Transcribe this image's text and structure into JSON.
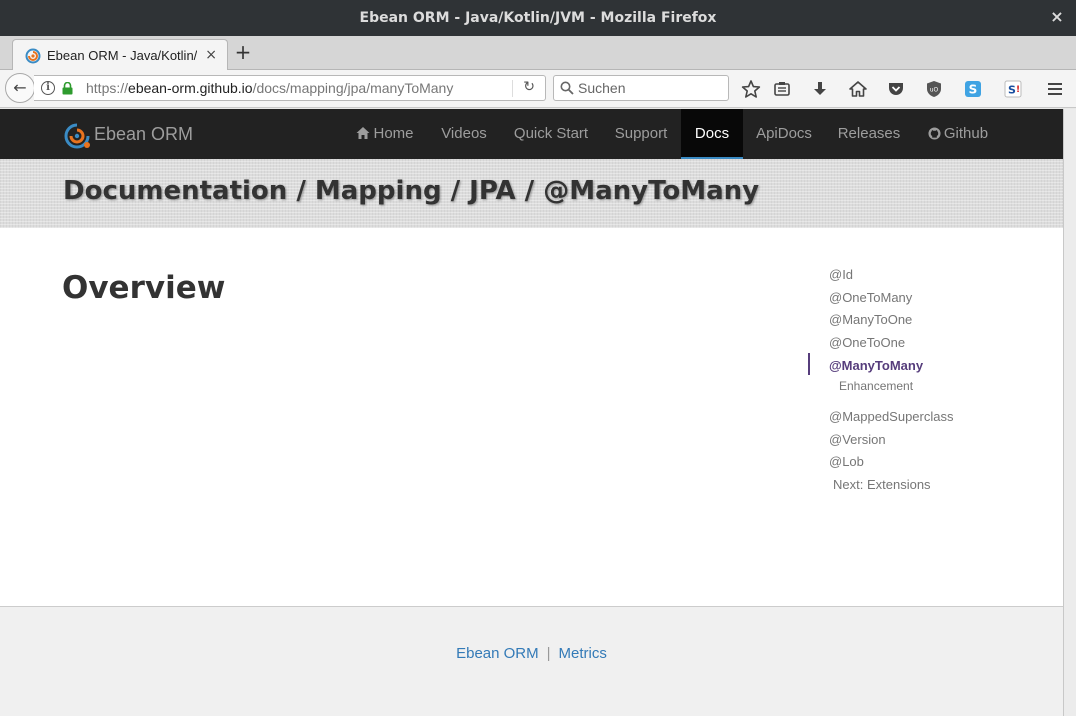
{
  "window": {
    "title": "Ebean ORM - Java/Kotlin/JVM - Mozilla Firefox",
    "close": "×"
  },
  "tabs": [
    {
      "title": "Ebean ORM - Java/Kotlin/JVM",
      "close": "×"
    }
  ],
  "new_tab": "+",
  "toolbar": {
    "back": "←",
    "url_scheme": "https://",
    "url_host": "ebean-orm.github.io",
    "url_path": "/docs/mapping/jpa/manyToMany",
    "reload": "↻",
    "search_placeholder": "Suchen",
    "icons": [
      "bookmark-star-icon",
      "reading-list-icon",
      "download-icon",
      "home-icon",
      "pocket-icon",
      "ublock-icon",
      "skype-icon",
      "si-icon",
      "menu-icon"
    ]
  },
  "site": {
    "brand": "Ebean ORM",
    "nav": [
      {
        "label": "Home",
        "active": false
      },
      {
        "label": "Videos",
        "active": false
      },
      {
        "label": "Quick Start",
        "active": false
      },
      {
        "label": "Support",
        "active": false
      },
      {
        "label": "Docs",
        "active": true
      },
      {
        "label": "ApiDocs",
        "active": false
      },
      {
        "label": "Releases",
        "active": false
      },
      {
        "label": "Github",
        "active": false
      }
    ],
    "breadcrumb_title": "Documentation / Mapping / JPA / @ManyToMany",
    "heading": "Overview",
    "toc": {
      "items": [
        "@Id",
        "@OneToMany",
        "@ManyToOne",
        "@OneToOne",
        "@ManyToMany"
      ],
      "active": "@ManyToMany",
      "sub": "Enhancement",
      "items_after": [
        "@MappedSuperclass",
        "@Version",
        "@Lob"
      ],
      "next": "Next: Extensions"
    },
    "footer": {
      "link1": "Ebean ORM",
      "separator": "|",
      "link2": "Metrics"
    }
  },
  "colors": {
    "nav_bg": "#222222",
    "active_accent": "#563d7c",
    "link": "#337ab7",
    "titlebar": "#2f3336"
  }
}
